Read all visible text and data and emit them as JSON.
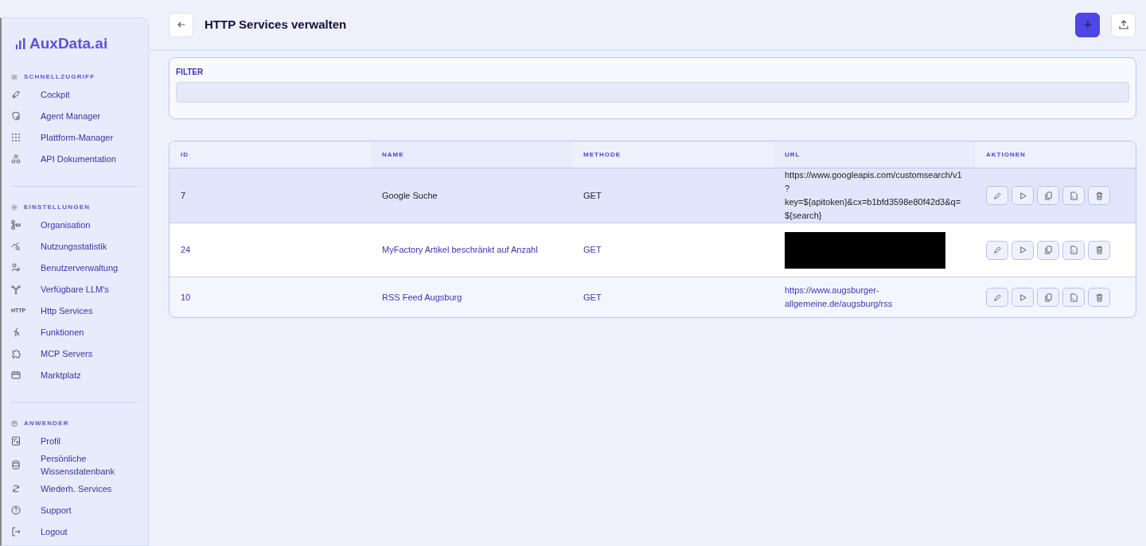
{
  "sidebar": {
    "logo": "AuxData.ai",
    "sections": [
      {
        "title": "SCHNELLZUGRIFF",
        "items": [
          {
            "label": "Cockpit"
          },
          {
            "label": "Agent Manager"
          },
          {
            "label": "Plattform-Manager"
          },
          {
            "label": "API Dokumentation"
          }
        ]
      },
      {
        "title": "EINSTELLUNGEN",
        "items": [
          {
            "label": "Organisation"
          },
          {
            "label": "Nutzungsstatistik"
          },
          {
            "label": "Benutzerverwaltung"
          },
          {
            "label": "Verfügbare LLM's"
          },
          {
            "label": "Http Services",
            "icon_text": "HTTP"
          },
          {
            "label": "Funktionen"
          },
          {
            "label": "MCP Servers"
          },
          {
            "label": "Marktplatz"
          }
        ]
      },
      {
        "title": "ANWENDER",
        "items": [
          {
            "label": "Profil"
          },
          {
            "label": "Persönliche Wissensdatenbank"
          },
          {
            "label": "Wiederh. Services"
          },
          {
            "label": "Support"
          },
          {
            "label": "Logout"
          }
        ]
      }
    ]
  },
  "header": {
    "title": "HTTP Services verwalten"
  },
  "filter": {
    "label": "FILTER"
  },
  "table": {
    "columns": [
      "ID",
      "NAME",
      "METHODE",
      "URL",
      "AKTIONEN"
    ],
    "rows": [
      {
        "id": "7",
        "name": "Google Suche",
        "method": "GET",
        "url": "https://www.googleapis.com/customsearch/v1?key=${apitoken}&cx=b1bfd3598e80f42d3&q=${search}",
        "redacted": false,
        "selected": true
      },
      {
        "id": "24",
        "name": "MyFactory Artikel beschränkt auf Anzahl",
        "method": "GET",
        "redacted": true,
        "selected": false
      },
      {
        "id": "10",
        "name": "RSS Feed Augsburg",
        "method": "GET",
        "url": "https://www.augsburger-allgemeine.de/augsburg/rss",
        "redacted": false,
        "selected": false
      }
    ]
  }
}
